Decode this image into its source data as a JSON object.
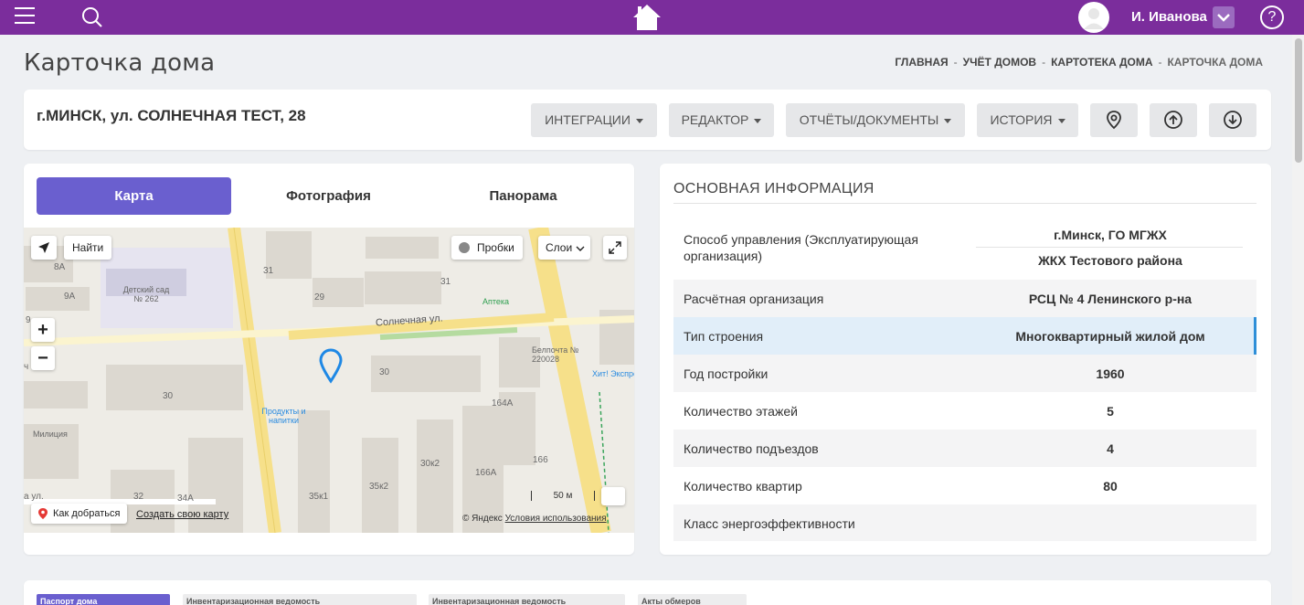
{
  "topbar": {
    "user_name": "И. Иванова",
    "help_label": "?",
    "accent_color": "#7b2d9c",
    "icons": [
      "menu-icon",
      "search-icon",
      "home-icon",
      "avatar-icon",
      "chevron-down-icon",
      "help-icon"
    ]
  },
  "page": {
    "title": "Карточка дома",
    "breadcrumb": [
      "ГЛАВНАЯ",
      "УЧЁТ ДОМОВ",
      "КАРТОТЕКА ДОМА",
      "КАРТОЧКА ДОМА"
    ],
    "breadcrumb_sep": "-"
  },
  "house": {
    "address": "г.МИНСК, ул. СОЛНЕЧНАЯ ТЕСТ, 28",
    "actions": [
      "ИНТЕГРАЦИИ",
      "РЕДАКТОР",
      "ОТЧЁТЫ/ДОКУМЕНТЫ",
      "ИСТОРИЯ"
    ],
    "icon_actions": [
      "location-pin-icon",
      "arrow-up-circle-icon",
      "arrow-down-circle-icon"
    ]
  },
  "media_tabs": [
    "Карта",
    "Фотография",
    "Панорама"
  ],
  "map": {
    "find_label": "Найти",
    "traffic_label": "Пробки",
    "layers_label": "Слои",
    "zoom_in": "+",
    "zoom_out": "−",
    "route_label": "Как добраться",
    "create_map_label": "Создать свою карту",
    "copyright": "© Яндекс",
    "terms_label": "Условия использования",
    "scale_label": "50 м",
    "street_label": "Солнечная ул.",
    "street_left": "а ул.",
    "house_numbers": [
      "8А",
      "9А",
      "31",
      "29",
      "31",
      "30",
      "30",
      "164А",
      "166",
      "166А",
      "30к2",
      "35к2",
      "35к1",
      "32",
      "34А",
      "9",
      "ч"
    ],
    "pois": {
      "kindergarten": "Детский сад № 262",
      "pharmacy": "Аптека",
      "post": "Белпочта № 220028",
      "products": "Продукты и напитки",
      "police": "Милиция",
      "shop": "Хит! Экспресс"
    }
  },
  "info": {
    "title": "ОСНОВНАЯ ИНФОРМАЦИЯ",
    "rows": [
      {
        "label": "Способ управления (Эксплуатирующая организация)",
        "value": "г.Минск, ГО МГЖХ",
        "value2": "ЖКХ Тестового района"
      },
      {
        "label": "Расчётная организация",
        "value": "РСЦ № 4 Ленинского р-на"
      },
      {
        "label": "Тип строения",
        "value": "Многоквартирный жилой дом"
      },
      {
        "label": "Год постройки",
        "value": "1960"
      },
      {
        "label": "Количество этажей",
        "value": "5"
      },
      {
        "label": "Количество подъездов",
        "value": "4"
      },
      {
        "label": "Количество квартир",
        "value": "80"
      },
      {
        "label": "Класс энергоэффективности",
        "value": ""
      }
    ]
  },
  "passport_tabs": [
    "Паспорт дома",
    "Инвентаризационная ведомость",
    "Инвентаризационная ведомость",
    "Акты обмеров"
  ]
}
